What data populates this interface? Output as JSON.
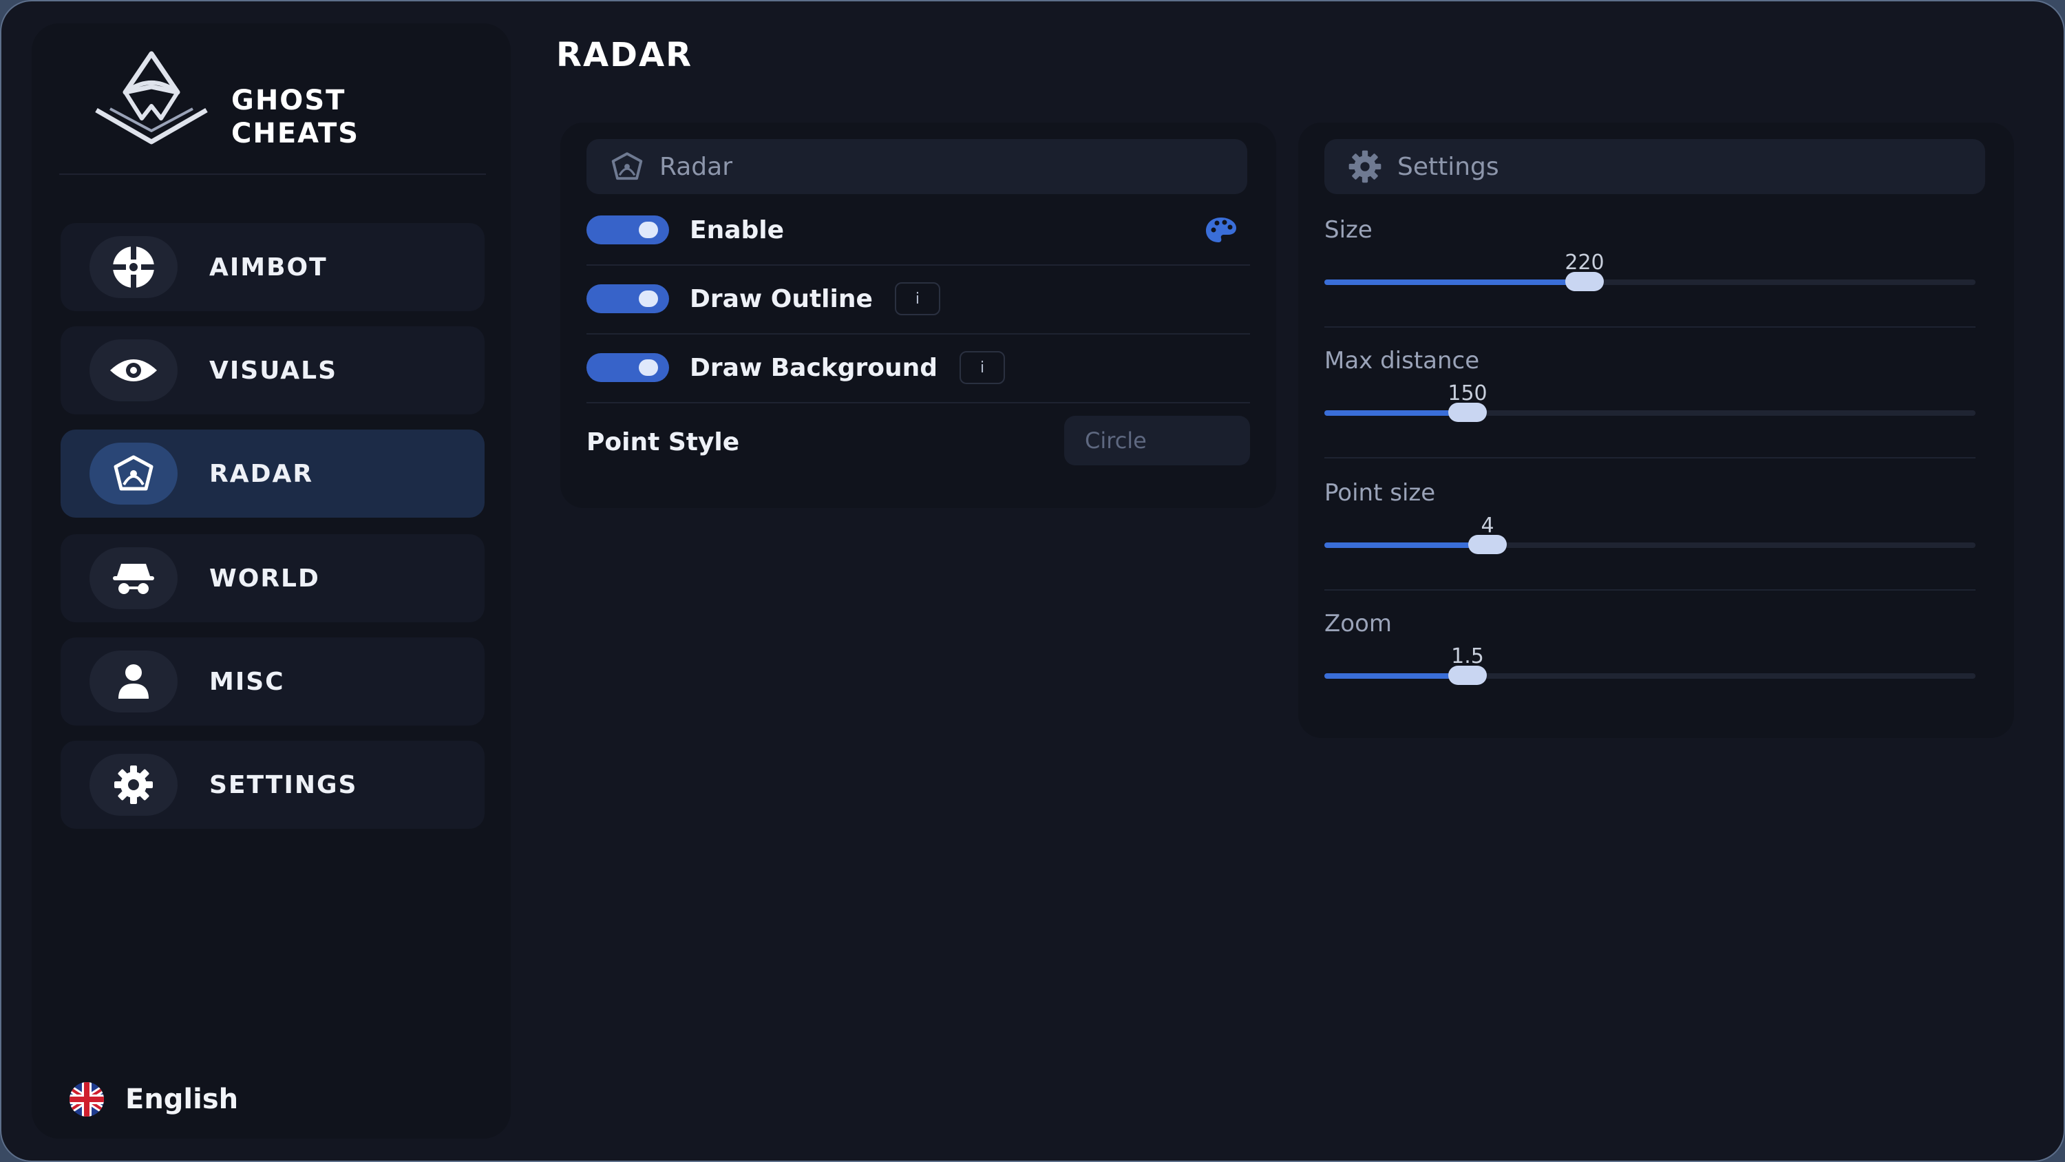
{
  "app": {
    "brand_line1": "GHOST",
    "brand_line2": "CHEATS",
    "page_title": "RADAR"
  },
  "sidebar": {
    "items": [
      {
        "label": "AIMBOT",
        "icon": "crosshair-icon"
      },
      {
        "label": "VISUALS",
        "icon": "eye-icon"
      },
      {
        "label": "RADAR",
        "icon": "radar-icon",
        "active": true
      },
      {
        "label": "WORLD",
        "icon": "spy-icon"
      },
      {
        "label": "MISC",
        "icon": "user-icon"
      },
      {
        "label": "SETTINGS",
        "icon": "gear-icon"
      }
    ],
    "language": "English"
  },
  "radar_panel": {
    "header": "Radar",
    "enable_label": "Enable",
    "draw_outline_label": "Draw Outline",
    "draw_background_label": "Draw Background",
    "info_glyph": "i",
    "point_style_label": "Point Style",
    "point_style_value": "Circle",
    "enable_on": true,
    "draw_outline_on": true,
    "draw_background_on": true
  },
  "settings_panel": {
    "header": "Settings",
    "sliders": [
      {
        "label": "Size",
        "value": "220",
        "fraction": 0.4
      },
      {
        "label": "Max distance",
        "value": "150",
        "fraction": 0.22
      },
      {
        "label": "Point size",
        "value": "4",
        "fraction": 0.25
      },
      {
        "label": "Zoom",
        "value": "1.5",
        "fraction": 0.22
      }
    ]
  },
  "colors": {
    "accent": "#3a6ed8",
    "background": "#131621",
    "panel": "#10131c"
  }
}
